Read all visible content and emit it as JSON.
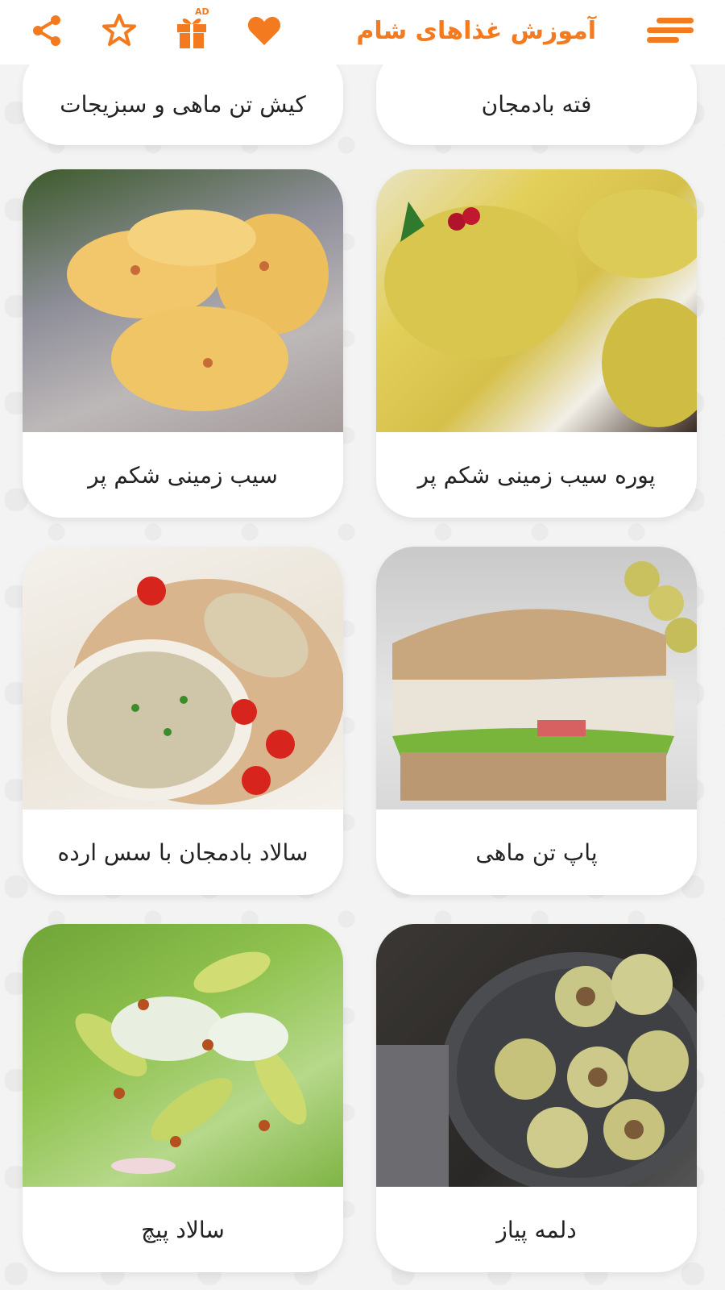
{
  "header": {
    "title": "آموزش غذاهای شام",
    "ad_badge": "AD",
    "icons": [
      "menu-icon",
      "heart-icon",
      "gift-ad-icon",
      "star-icon",
      "share-icon"
    ],
    "accent_color": "#f47a1f"
  },
  "recipes": [
    {
      "label": "فته بادمجان"
    },
    {
      "label": "کیش تن ماهی و سبزیجات"
    },
    {
      "label": "پوره سیب زمینی شکم پر"
    },
    {
      "label": "سیب زمینی شکم پر"
    },
    {
      "label": "پاپ تن ماهی"
    },
    {
      "label": "سالاد بادمجان با سس ارده"
    },
    {
      "label": "دلمه پیاز"
    },
    {
      "label": "سالاد پیچ"
    }
  ]
}
